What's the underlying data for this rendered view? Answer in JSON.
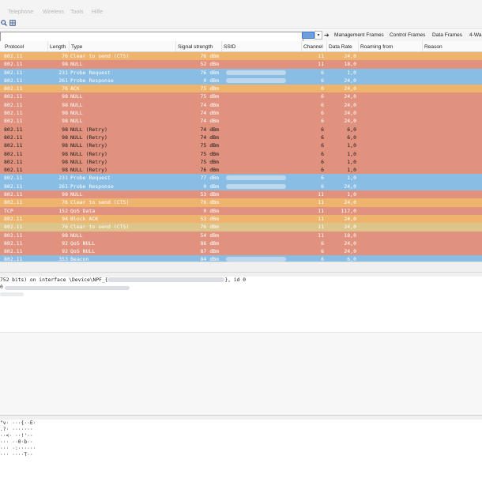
{
  "menu": {
    "items": [
      "Telephone",
      "Wireless",
      "Tools",
      "Hilfe"
    ]
  },
  "toolbar": {
    "icons": [
      "zoom-icon",
      "resize-columns-icon"
    ]
  },
  "filter": {
    "value": "",
    "dropdown_glyph": "▾",
    "arrow_glyph": "➔",
    "buttons": [
      "Management Frames",
      "Control Frames",
      "Data Frames",
      "4-Wa"
    ]
  },
  "columns": [
    "Protocol",
    "Length",
    "Type",
    "Signal strength",
    "SSID",
    "Channel",
    "Data Rate",
    "Roaming from",
    "Reason"
  ],
  "colors": {
    "orange": "#eeb36d",
    "salmon": "#e1927e",
    "blue": "#89bde3",
    "yellow_dim": "#dcc48a"
  },
  "rows": [
    {
      "protocol": "802.11",
      "length": "76",
      "type": "Clear to send (CTS)",
      "signal": "76 dBm",
      "ssid": false,
      "channel": "11",
      "rate": "24,0",
      "color": "orange",
      "text": "#ffffff"
    },
    {
      "protocol": "802.11",
      "length": "98",
      "type": "NULL",
      "signal": "52 dBm",
      "ssid": false,
      "channel": "11",
      "rate": "18,0",
      "color": "salmon",
      "text": "#ffffff"
    },
    {
      "protocol": "802.11",
      "length": "231",
      "type": "Probe Request",
      "signal": "76 dBm",
      "ssid": true,
      "channel": "6",
      "rate": "1,0",
      "color": "blue",
      "text": "#ffffff"
    },
    {
      "protocol": "802.11",
      "length": "261",
      "type": "Probe Response",
      "signal": "0 dBm",
      "ssid": true,
      "channel": "6",
      "rate": "24,0",
      "color": "blue",
      "text": "#ffffff"
    },
    {
      "protocol": "802.11",
      "length": "76",
      "type": "ACK",
      "signal": "75 dBm",
      "ssid": false,
      "channel": "6",
      "rate": "24,0",
      "color": "orange",
      "text": "#ffffff"
    },
    {
      "protocol": "802.11",
      "length": "98",
      "type": "NULL",
      "signal": "75 dBm",
      "ssid": false,
      "channel": "6",
      "rate": "24,0",
      "color": "salmon",
      "text": "#ffffff"
    },
    {
      "protocol": "802.11",
      "length": "98",
      "type": "NULL",
      "signal": "74 dBm",
      "ssid": false,
      "channel": "6",
      "rate": "24,0",
      "color": "salmon",
      "text": "#ffffff"
    },
    {
      "protocol": "802.11",
      "length": "98",
      "type": "NULL",
      "signal": "74 dBm",
      "ssid": false,
      "channel": "6",
      "rate": "24,0",
      "color": "salmon",
      "text": "#ffffff"
    },
    {
      "protocol": "802.11",
      "length": "98",
      "type": "NULL",
      "signal": "74 dBm",
      "ssid": false,
      "channel": "6",
      "rate": "24,0",
      "color": "salmon",
      "text": "#ffffff"
    },
    {
      "protocol": "802.11",
      "length": "98",
      "type": "NULL (Retry)",
      "signal": "74 dBm",
      "ssid": false,
      "channel": "6",
      "rate": "6,0",
      "color": "salmon",
      "text": "#1a1a1a"
    },
    {
      "protocol": "802.11",
      "length": "98",
      "type": "NULL (Retry)",
      "signal": "74 dBm",
      "ssid": false,
      "channel": "6",
      "rate": "6,0",
      "color": "salmon",
      "text": "#1a1a1a"
    },
    {
      "protocol": "802.11",
      "length": "98",
      "type": "NULL (Retry)",
      "signal": "75 dBm",
      "ssid": false,
      "channel": "6",
      "rate": "1,0",
      "color": "salmon",
      "text": "#1a1a1a"
    },
    {
      "protocol": "802.11",
      "length": "98",
      "type": "NULL (Retry)",
      "signal": "75 dBm",
      "ssid": false,
      "channel": "6",
      "rate": "1,0",
      "color": "salmon",
      "text": "#1a1a1a"
    },
    {
      "protocol": "802.11",
      "length": "98",
      "type": "NULL (Retry)",
      "signal": "75 dBm",
      "ssid": false,
      "channel": "6",
      "rate": "1,0",
      "color": "salmon",
      "text": "#1a1a1a"
    },
    {
      "protocol": "802.11",
      "length": "98",
      "type": "NULL (Retry)",
      "signal": "76 dBm",
      "ssid": false,
      "channel": "6",
      "rate": "1,0",
      "color": "salmon",
      "text": "#1a1a1a"
    },
    {
      "protocol": "802.11",
      "length": "231",
      "type": "Probe Request",
      "signal": "77 dBm",
      "ssid": true,
      "channel": "6",
      "rate": "1,0",
      "color": "blue",
      "text": "#ffffff"
    },
    {
      "protocol": "802.11",
      "length": "261",
      "type": "Probe Response",
      "signal": "0 dBm",
      "ssid": true,
      "channel": "6",
      "rate": "24,0",
      "color": "blue",
      "text": "#ffffff"
    },
    {
      "protocol": "802.11",
      "length": "98",
      "type": "NULL",
      "signal": "53 dBm",
      "ssid": false,
      "channel": "11",
      "rate": "1,0",
      "color": "salmon",
      "text": "#ffffff"
    },
    {
      "protocol": "802.11",
      "length": "76",
      "type": "Clear to send (CTS)",
      "signal": "76 dBm",
      "ssid": false,
      "channel": "11",
      "rate": "24,0",
      "color": "orange",
      "text": "#ffffff"
    },
    {
      "protocol": "TCP",
      "length": "152",
      "type": "QoS Data",
      "signal": "0 dBm",
      "ssid": false,
      "channel": "11",
      "rate": "117,0",
      "color": "salmon",
      "text": "#ffffff"
    },
    {
      "protocol": "802.11",
      "length": "94",
      "type": "Block ACK",
      "signal": "53 dBm",
      "ssid": false,
      "channel": "11",
      "rate": "24,0",
      "color": "orange",
      "text": "#ffffff"
    },
    {
      "protocol": "802.11",
      "length": "76",
      "type": "Clear to send (CTS)",
      "signal": "76 dBm",
      "ssid": false,
      "channel": "11",
      "rate": "24,0",
      "color": "yellow_dim",
      "text": "#ffffff"
    },
    {
      "protocol": "802.11",
      "length": "98",
      "type": "NULL",
      "signal": "54 dBm",
      "ssid": false,
      "channel": "11",
      "rate": "18,0",
      "color": "salmon",
      "text": "#ffffff"
    },
    {
      "protocol": "802.11",
      "length": "92",
      "type": "QoS NULL",
      "signal": "86 dBm",
      "ssid": false,
      "channel": "6",
      "rate": "24,0",
      "color": "salmon",
      "text": "#ffffff"
    },
    {
      "protocol": "802.11",
      "length": "92",
      "type": "QoS NULL",
      "signal": "87 dBm",
      "ssid": false,
      "channel": "6",
      "rate": "24,0",
      "color": "salmon",
      "text": "#ffffff"
    },
    {
      "protocol": "802.11",
      "length": "353",
      "type": "Beacon",
      "signal": "84 dBm",
      "ssid": true,
      "channel": "6",
      "rate": "6,0",
      "color": "blue",
      "text": "#ffffff"
    }
  ],
  "details": {
    "line1_prefix": "752 bits) on interface \\Device\\NPF_{",
    "line1_suffix": "}, id 0",
    "line2": "0"
  },
  "bytes": {
    "lines": [
      "\"v· ···{··E·",
      ".?· ·······",
      "··<· ··!'··",
      "··· ··0·b··",
      "··· ·:······",
      "··· ····T··"
    ]
  }
}
